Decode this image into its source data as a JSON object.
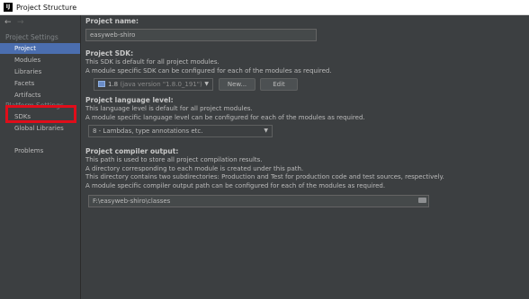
{
  "window": {
    "title": "Project Structure",
    "logo_text": "IJ"
  },
  "nav": {
    "back_glyph": "←",
    "forward_glyph": "→"
  },
  "sidebar": {
    "project_settings_header": "Project Settings",
    "platform_settings_header": "Platform Settings",
    "items": [
      {
        "label": "Project",
        "selected": true
      },
      {
        "label": "Modules"
      },
      {
        "label": "Libraries"
      },
      {
        "label": "Facets"
      },
      {
        "label": "Artifacts"
      },
      {
        "label": "SDKs"
      },
      {
        "label": "Global Libraries"
      },
      {
        "label": "Problems"
      }
    ]
  },
  "project_name": {
    "label": "Project name:",
    "value": "easyweb-shiro"
  },
  "project_sdk": {
    "label": "Project SDK:",
    "desc1": "This SDK is default for all project modules.",
    "desc2": "A module specific SDK can be configured for each of the modules as required.",
    "selected_name": "1.8",
    "selected_version": "(java version \"1.8.0_191\")",
    "new_button": "New...",
    "edit_button": "Edit"
  },
  "language_level": {
    "label": "Project language level:",
    "desc1": "This language level is default for all project modules.",
    "desc2": "A module specific language level can be configured for each of the modules as required.",
    "selected": "8 - Lambdas, type annotations etc."
  },
  "compiler_output": {
    "label": "Project compiler output:",
    "desc1": "This path is used to store all project compilation results.",
    "desc2": "A directory corresponding to each module is created under this path.",
    "desc3": "This directory contains two subdirectories: Production and Test for production code and test sources, respectively.",
    "desc4": "A module specific compiler output path can be configured for each of the modules as required.",
    "path": "F:\\easyweb-shiro\\classes"
  },
  "colors": {
    "background": "#3c3f41",
    "selection": "#4b6eaf",
    "highlight_box": "#e00d1a"
  }
}
